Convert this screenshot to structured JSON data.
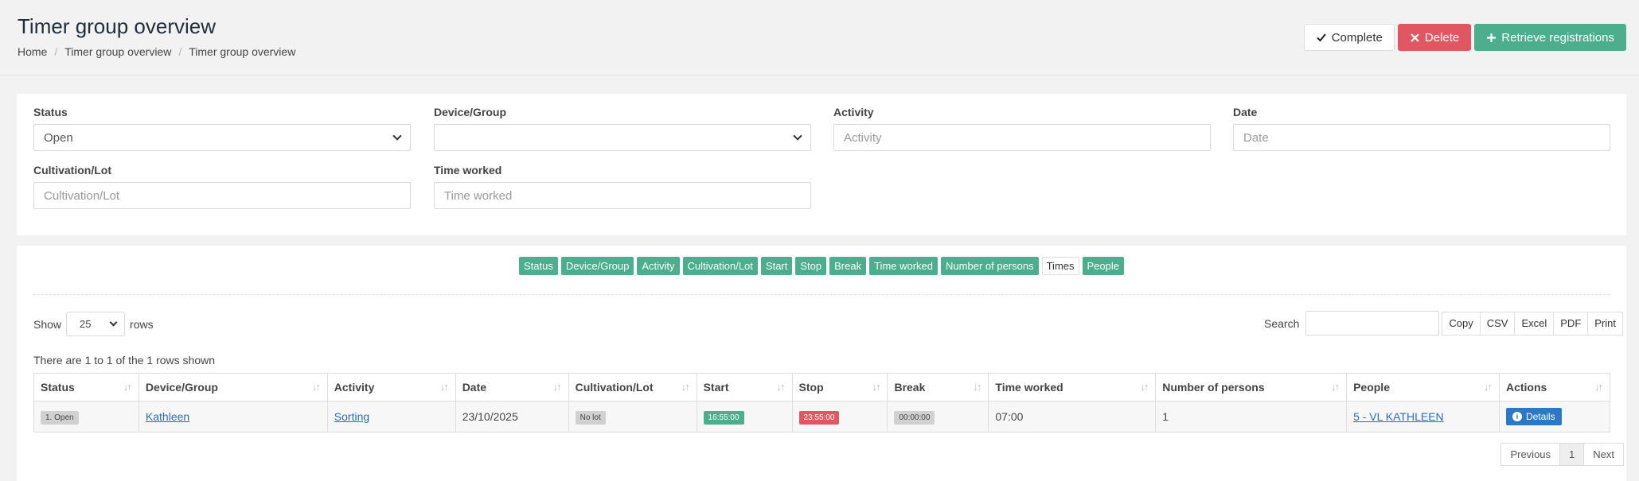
{
  "header": {
    "title": "Timer group overview",
    "breadcrumb": [
      "Home",
      "Timer group overview",
      "Timer group overview"
    ],
    "actions": {
      "complete": "Complete",
      "delete": "Delete",
      "retrieve": "Retrieve registrations"
    }
  },
  "filters": {
    "status": {
      "label": "Status",
      "value": "Open"
    },
    "device": {
      "label": "Device/Group",
      "value": ""
    },
    "activity": {
      "label": "Activity",
      "placeholder": "Activity"
    },
    "date": {
      "label": "Date",
      "placeholder": "Date"
    },
    "cultivation": {
      "label": "Cultivation/Lot",
      "placeholder": "Cultivation/Lot"
    },
    "time_worked": {
      "label": "Time worked",
      "placeholder": "Time worked"
    }
  },
  "column_toggles": [
    "Status",
    "Device/Group",
    "Activity",
    "Cultivation/Lot",
    "Start",
    "Stop",
    "Break",
    "Time worked",
    "Number of persons",
    "Times",
    "People"
  ],
  "table_controls": {
    "show": "Show",
    "page_size": "25",
    "rows": "rows",
    "search_label": "Search",
    "export": [
      "Copy",
      "CSV",
      "Excel",
      "PDF",
      "Print"
    ],
    "info": "There are 1 to 1 of the 1 rows shown"
  },
  "table": {
    "headers": [
      "Status",
      "Device/Group",
      "Activity",
      "Date",
      "Cultivation/Lot",
      "Start",
      "Stop",
      "Break",
      "Time worked",
      "Number of persons",
      "People",
      "Actions"
    ],
    "rows": [
      {
        "status": "1. Open",
        "device": "Kathleen",
        "activity": "Sorting",
        "date": "23/10/2025",
        "lot": "No lot",
        "start": "16:55:00",
        "stop": "23:55:00",
        "break": "00:00:00",
        "time_worked": "07:00",
        "persons": "1",
        "people": "5 - VL KATHLEEN",
        "action": "Details"
      }
    ]
  },
  "pagination": {
    "previous": "Previous",
    "page": "1",
    "next": "Next"
  },
  "colors": {
    "green": "#4cae8c",
    "red": "#e05661",
    "blue": "#2b78c5"
  }
}
